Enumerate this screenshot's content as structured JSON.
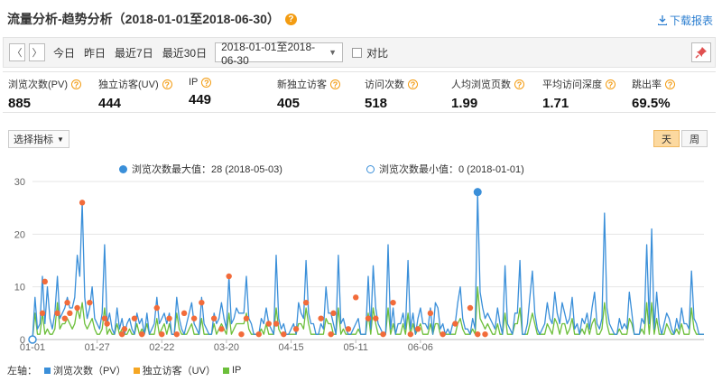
{
  "header": {
    "title": "流量分析-趋势分析（2018-01-01至2018-06-30）",
    "download_label": "下载报表"
  },
  "toolbar": {
    "prev_label": "〈",
    "next_label": "〉",
    "today": "今日",
    "yesterday": "昨日",
    "last7": "最近7日",
    "last30": "最近30日",
    "date_range": "2018-01-01至2018-06-30",
    "compare_label": "对比"
  },
  "metrics": [
    {
      "label": "浏览次数(PV)",
      "value": "885"
    },
    {
      "label": "独立访客(UV)",
      "value": "444"
    },
    {
      "label": "IP",
      "value": "449"
    },
    {
      "label": "新独立访客",
      "value": "405"
    },
    {
      "label": "访问次数",
      "value": "518"
    },
    {
      "label": "人均浏览页数",
      "value": "1.99"
    },
    {
      "label": "平均访问深度",
      "value": "1.71"
    },
    {
      "label": "跳出率",
      "value": "69.5%"
    }
  ],
  "controls": {
    "select_metric": "选择指标",
    "day": "天",
    "week": "周"
  },
  "chart_data": {
    "type": "line",
    "x_ticks": [
      "01-01",
      "01-27",
      "02-22",
      "03-20",
      "04-15",
      "05-11",
      "06-06"
    ],
    "y_ticks": [
      0,
      10,
      20,
      30
    ],
    "ylim": [
      0,
      30
    ],
    "x_start": "2018-01-01",
    "max_note": "浏览次数最大值：28 (2018-05-03)",
    "min_note": "浏览次数最小值：0 (2018-01-01)",
    "axis_label": "左轴：",
    "series": [
      {
        "name": "浏览次数（PV）",
        "color": "#3a8fd9",
        "values": [
          0,
          8,
          2,
          3,
          12,
          3,
          10,
          4,
          2,
          5,
          12,
          4,
          5,
          6,
          8,
          6,
          6,
          8,
          16,
          12,
          26,
          8,
          4,
          6,
          10,
          4,
          3,
          2,
          5,
          18,
          3,
          5,
          2,
          1,
          6,
          2,
          4,
          1,
          3,
          4,
          2,
          1,
          5,
          3,
          4,
          1,
          5,
          1,
          2,
          3,
          8,
          3,
          4,
          5,
          3,
          5,
          1,
          1,
          8,
          4,
          2,
          1,
          3,
          5,
          7,
          3,
          2,
          1,
          8,
          3,
          2,
          1,
          1,
          5,
          3,
          4,
          7,
          4,
          2,
          12,
          3,
          4,
          6,
          5,
          5,
          5,
          12,
          4,
          3,
          1,
          1,
          1,
          4,
          3,
          6,
          3,
          2,
          1,
          16,
          4,
          2,
          3,
          1,
          1,
          2,
          3,
          1,
          7,
          5,
          4,
          15,
          5,
          3,
          3,
          1,
          1,
          3,
          2,
          10,
          5,
          5,
          3,
          1,
          16,
          3,
          4,
          2,
          1,
          1,
          2,
          3,
          4,
          1,
          1,
          1,
          12,
          2,
          14,
          6,
          3,
          2,
          1,
          1,
          18,
          2,
          6,
          1,
          3,
          3,
          5,
          2,
          15,
          2,
          5,
          1,
          4,
          6,
          3,
          3,
          2,
          6,
          1,
          7,
          6,
          2,
          3,
          1,
          2,
          1,
          3,
          3,
          7,
          10,
          4,
          2,
          2,
          1,
          4,
          2,
          28,
          9,
          6,
          4,
          5,
          4,
          3,
          2,
          6,
          3,
          1,
          14,
          3,
          2,
          1,
          5,
          5,
          15,
          1,
          1,
          3,
          8,
          13,
          5,
          2,
          1,
          2,
          3,
          7,
          4,
          3,
          9,
          5,
          3,
          7,
          5,
          3,
          4,
          8,
          2,
          3,
          1,
          4,
          3,
          5,
          2,
          6,
          9,
          3,
          2,
          4,
          24,
          6,
          3,
          2,
          1,
          1,
          4,
          2,
          3,
          2,
          9,
          5,
          1,
          1,
          1,
          4,
          3,
          18,
          3,
          21,
          2,
          9,
          3,
          1,
          3,
          5,
          4,
          2,
          1,
          4,
          2,
          6,
          3,
          3,
          2,
          13,
          4,
          3,
          1,
          1,
          1
        ],
        "dot_values": []
      },
      {
        "name": "独立访客（UV）",
        "color": "#f5a623",
        "values": []
      },
      {
        "name": "IP",
        "color": "#6cbf3a",
        "values": [
          0,
          5,
          1,
          1,
          5,
          1,
          2,
          1,
          1,
          2,
          7,
          2,
          3,
          3,
          4,
          3,
          2,
          3,
          6,
          4,
          7,
          3,
          2,
          3,
          4,
          2,
          1,
          1,
          2,
          6,
          1,
          2,
          1,
          1,
          3,
          1,
          2,
          1,
          1,
          2,
          1,
          1,
          3,
          1,
          2,
          1,
          3,
          1,
          1,
          1,
          4,
          1,
          2,
          3,
          1,
          3,
          1,
          1,
          5,
          2,
          1,
          1,
          1,
          2,
          3,
          1,
          1,
          1,
          4,
          1,
          1,
          1,
          1,
          3,
          1,
          2,
          3,
          2,
          1,
          5,
          1,
          2,
          3,
          3,
          3,
          3,
          5,
          2,
          1,
          1,
          1,
          1,
          2,
          1,
          3,
          1,
          1,
          1,
          6,
          2,
          1,
          1,
          1,
          1,
          1,
          1,
          1,
          3,
          3,
          2,
          6,
          3,
          1,
          1,
          1,
          1,
          1,
          1,
          4,
          3,
          3,
          1,
          1,
          6,
          1,
          2,
          1,
          1,
          1,
          1,
          1,
          2,
          1,
          1,
          1,
          5,
          1,
          6,
          3,
          1,
          1,
          1,
          1,
          6,
          1,
          3,
          1,
          1,
          1,
          3,
          1,
          5,
          1,
          3,
          1,
          2,
          3,
          1,
          1,
          1,
          3,
          1,
          3,
          3,
          1,
          1,
          1,
          1,
          1,
          1,
          1,
          3,
          4,
          2,
          1,
          1,
          1,
          2,
          1,
          10,
          4,
          3,
          2,
          3,
          2,
          1,
          1,
          3,
          1,
          1,
          5,
          1,
          1,
          1,
          3,
          3,
          6,
          1,
          1,
          1,
          3,
          5,
          3,
          1,
          1,
          1,
          1,
          3,
          2,
          1,
          4,
          3,
          1,
          3,
          3,
          1,
          2,
          4,
          1,
          1,
          1,
          2,
          1,
          3,
          1,
          3,
          4,
          1,
          1,
          2,
          7,
          3,
          1,
          1,
          1,
          1,
          2,
          1,
          1,
          1,
          4,
          3,
          1,
          1,
          1,
          2,
          1,
          7,
          1,
          7,
          1,
          4,
          1,
          1,
          1,
          3,
          2,
          1,
          1,
          2,
          1,
          3,
          1,
          1,
          1,
          6,
          2,
          1,
          1,
          1,
          1
        ]
      }
    ],
    "orange_dots": [
      [
        0,
        0
      ],
      [
        4,
        5
      ],
      [
        5,
        11
      ],
      [
        10,
        5
      ],
      [
        13,
        4
      ],
      [
        14,
        7
      ],
      [
        15,
        5
      ],
      [
        18,
        6
      ],
      [
        20,
        26
      ],
      [
        23,
        7
      ],
      [
        29,
        4
      ],
      [
        30,
        3
      ],
      [
        36,
        1
      ],
      [
        37,
        2
      ],
      [
        41,
        4
      ],
      [
        44,
        1
      ],
      [
        50,
        6
      ],
      [
        52,
        1
      ],
      [
        55,
        4
      ],
      [
        58,
        1
      ],
      [
        61,
        5
      ],
      [
        65,
        4
      ],
      [
        68,
        7
      ],
      [
        73,
        4
      ],
      [
        76,
        2
      ],
      [
        79,
        12
      ],
      [
        84,
        1
      ],
      [
        86,
        4
      ],
      [
        91,
        1
      ],
      [
        95,
        3
      ],
      [
        98,
        3
      ],
      [
        101,
        1
      ],
      [
        106,
        2
      ],
      [
        110,
        7
      ],
      [
        116,
        4
      ],
      [
        120,
        1
      ],
      [
        121,
        5
      ],
      [
        127,
        2
      ],
      [
        130,
        8
      ],
      [
        135,
        4
      ],
      [
        138,
        4
      ],
      [
        141,
        1
      ],
      [
        145,
        7
      ],
      [
        152,
        1
      ],
      [
        155,
        2
      ],
      [
        160,
        5
      ],
      [
        165,
        1
      ],
      [
        170,
        3
      ],
      [
        176,
        6
      ],
      [
        179,
        1
      ],
      [
        182,
        1
      ]
    ]
  }
}
